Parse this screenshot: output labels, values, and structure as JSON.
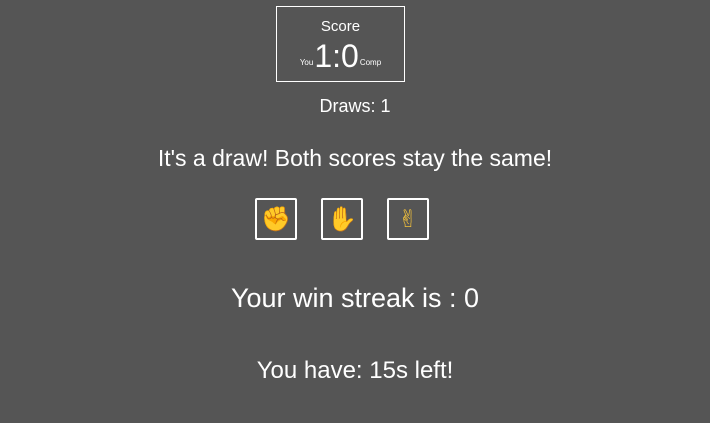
{
  "scoreboard": {
    "title": "Score",
    "you_label": "You",
    "comp_label": "Comp",
    "score": "1:0"
  },
  "draws": "Draws: 1",
  "message": "It's a draw! Both scores stay the same!",
  "choices": [
    {
      "name": "rock",
      "icon": "✊"
    },
    {
      "name": "paper",
      "icon": "✋"
    },
    {
      "name": "scissors",
      "icon": "✌"
    }
  ],
  "streak": "Your win streak is : 0",
  "timer": "You have: 15s left!",
  "colors": {
    "background": "#555555",
    "text": "#ffffff",
    "icon": "#f3c13a"
  }
}
